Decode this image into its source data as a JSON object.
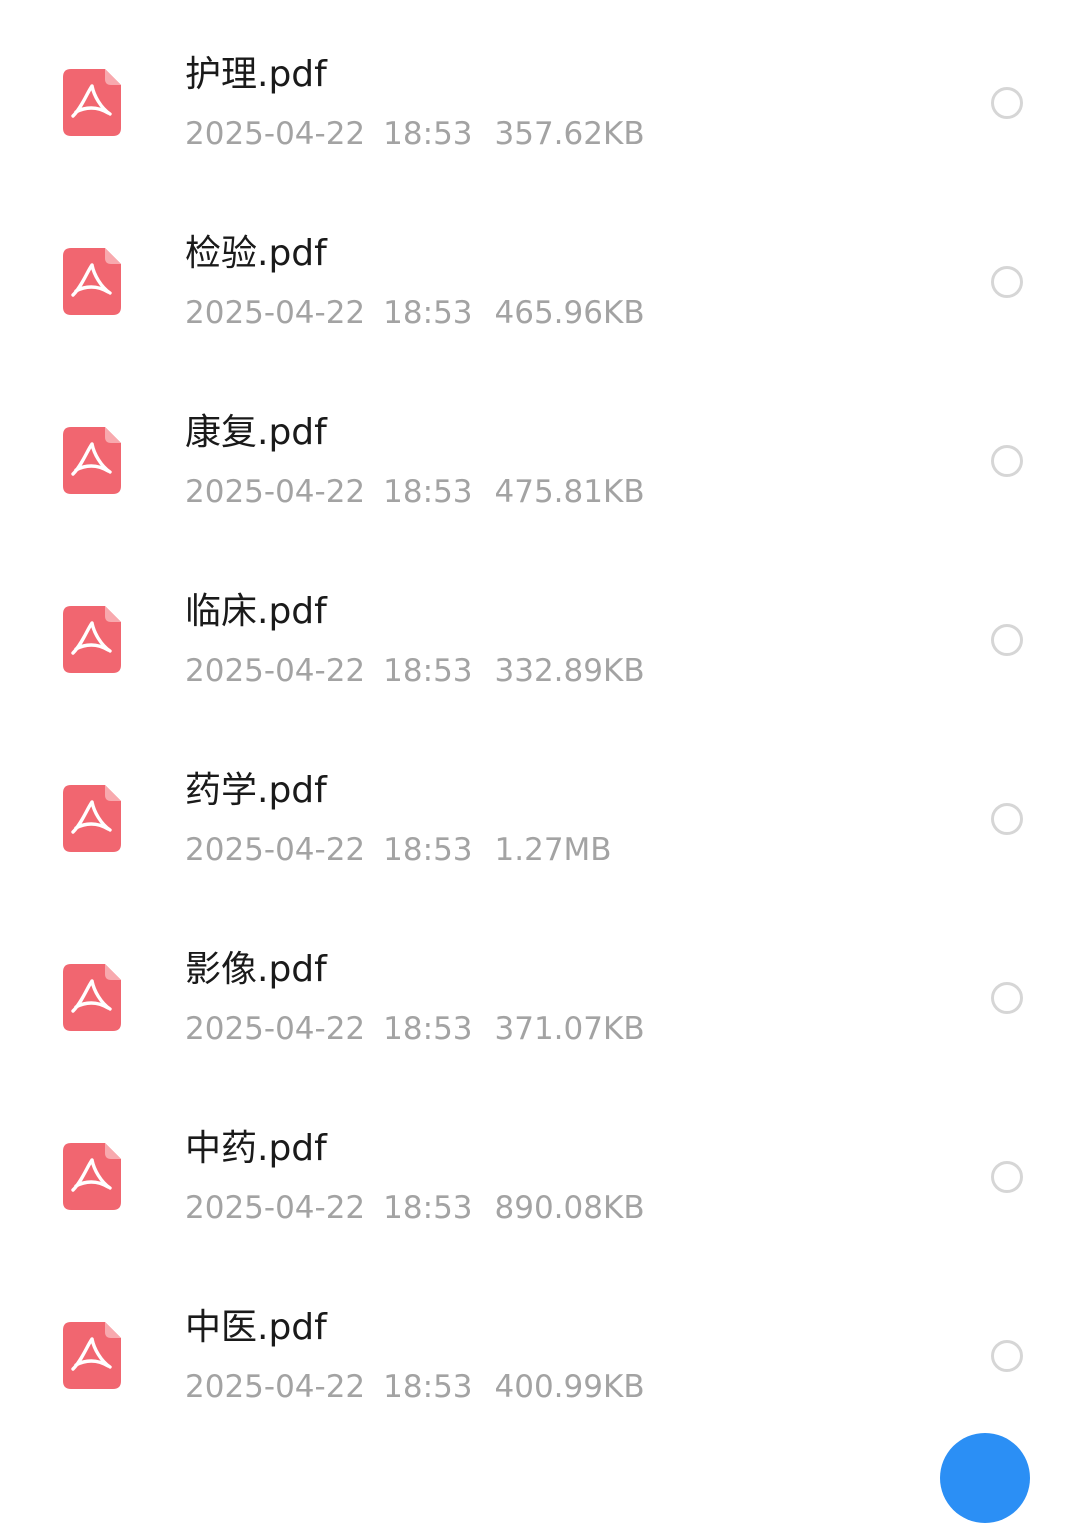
{
  "colors": {
    "pdf_icon": "#f16670",
    "file_name": "#1a1a1a",
    "meta_text": "#a3a3a3",
    "radio_border": "#d6d6d6",
    "fab": "#2b8ff5"
  },
  "file_icon": "pdf-icon",
  "files": [
    {
      "name": "护理.pdf",
      "date": "2025-04-22",
      "time": "18:53",
      "size": "357.62KB"
    },
    {
      "name": "检验.pdf",
      "date": "2025-04-22",
      "time": "18:53",
      "size": "465.96KB"
    },
    {
      "name": "康复.pdf",
      "date": "2025-04-22",
      "time": "18:53",
      "size": "475.81KB"
    },
    {
      "name": "临床.pdf",
      "date": "2025-04-22",
      "time": "18:53",
      "size": "332.89KB"
    },
    {
      "name": "药学.pdf",
      "date": "2025-04-22",
      "time": "18:53",
      "size": "1.27MB"
    },
    {
      "name": "影像.pdf",
      "date": "2025-04-22",
      "time": "18:53",
      "size": "371.07KB"
    },
    {
      "name": "中药.pdf",
      "date": "2025-04-22",
      "time": "18:53",
      "size": "890.08KB"
    },
    {
      "name": "中医.pdf",
      "date": "2025-04-22",
      "time": "18:53",
      "size": "400.99KB"
    }
  ]
}
